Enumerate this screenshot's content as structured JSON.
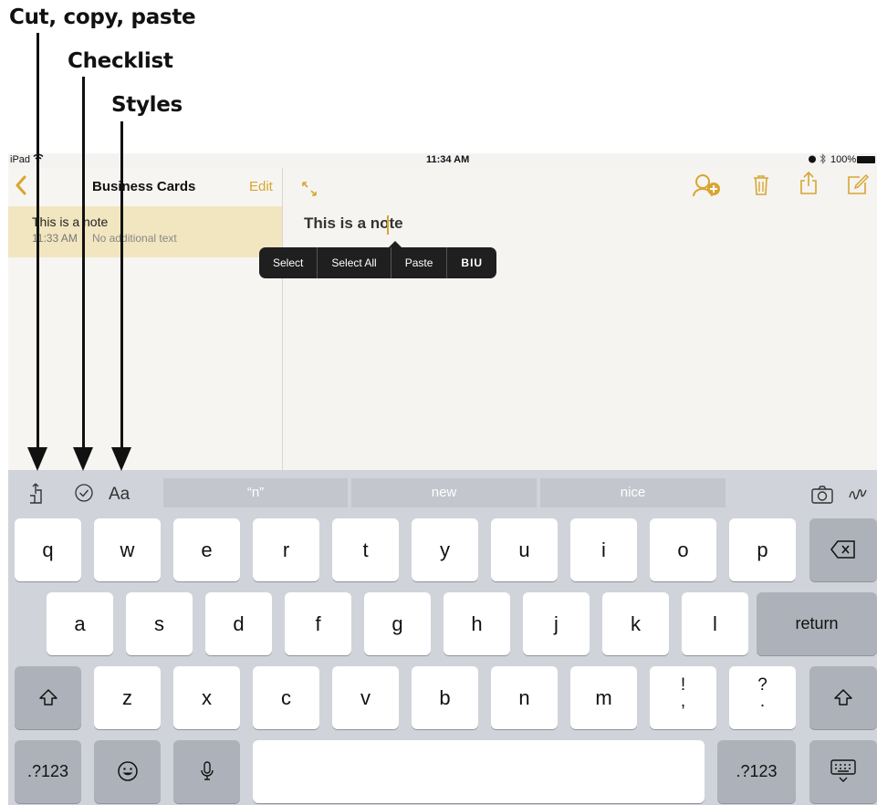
{
  "callouts": {
    "cut_copy_paste": "Cut, copy, paste",
    "checklist": "Checklist",
    "styles": "Styles"
  },
  "status_bar": {
    "device": "iPad",
    "time": "11:34 AM",
    "battery": "100%"
  },
  "sidebar": {
    "back_icon": "chevron-left-icon",
    "title": "Business Cards",
    "edit_label": "Edit",
    "notes": [
      {
        "title": "This is a note",
        "time": "11:33 AM",
        "preview": "No additional text"
      }
    ]
  },
  "note": {
    "text": "This is a note"
  },
  "toolbar_icons": [
    "expand-icon",
    "add-people-icon",
    "trash-icon",
    "share-icon",
    "compose-icon"
  ],
  "context_menu": {
    "select": "Select",
    "select_all": "Select All",
    "paste": "Paste",
    "format": "BIU"
  },
  "keyboard": {
    "suggestions": [
      "“n”",
      "new",
      "nice"
    ],
    "row1": [
      "q",
      "w",
      "e",
      "r",
      "t",
      "y",
      "u",
      "i",
      "o",
      "p"
    ],
    "row2": [
      "a",
      "s",
      "d",
      "f",
      "g",
      "h",
      "j",
      "k",
      "l"
    ],
    "row3": [
      "z",
      "x",
      "c",
      "v",
      "b",
      "n",
      "m"
    ],
    "punct1_top": "!",
    "punct1_bottom": ",",
    "punct2_top": "?",
    "punct2_bottom": ".",
    "return_label": "return",
    "numbers_label": ".?123",
    "styles_label": "Aa"
  },
  "colors": {
    "accent": "#d9a52f",
    "selected_row": "#f1e6bf",
    "keyboard_bg": "#d0d3d9"
  }
}
